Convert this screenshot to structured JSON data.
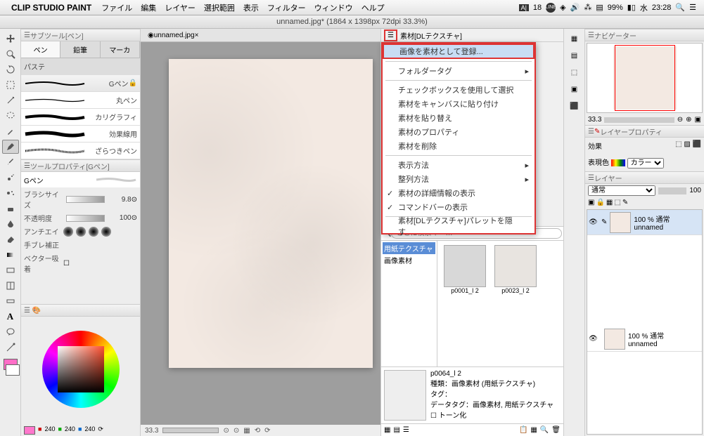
{
  "menubar": {
    "apple": "",
    "app": "CLIP STUDIO PAINT",
    "items": [
      "ファイル",
      "編集",
      "レイヤー",
      "選択範囲",
      "表示",
      "フィルター",
      "ウィンドウ",
      "ヘルプ"
    ],
    "status": {
      "adobe": "18",
      "battery": "99%",
      "day": "水",
      "time": "23:28"
    }
  },
  "titlebar": "unnamed.jpg* (1864 x 1398px 72dpi 33.3%)",
  "subtool": {
    "title": "サブツール[ペン]",
    "tabs": [
      "ペン",
      "鉛筆",
      "マーカ"
    ],
    "pastel": "パステ",
    "brushes": [
      "Gペン",
      "丸ペン",
      "カリグラフィ",
      "効果線用",
      "ざらつきペン"
    ]
  },
  "toolprop": {
    "title": "ツールプロパティ[Gペン]",
    "name": "Gペン",
    "rows": {
      "size_lbl": "ブラシサイズ",
      "size_val": "9.8",
      "opac_lbl": "不透明度",
      "opac_val": "100",
      "aa_lbl": "アンチエイ",
      "stab_lbl": "手ブレ補正",
      "vec_lbl": "ベクター吸着"
    }
  },
  "color": {
    "r": "240",
    "g": "240",
    "b": "240"
  },
  "canvas": {
    "tab": "unnamed.jpg",
    "zoom": "33.3"
  },
  "material": {
    "title": "素材[DLテクスチャ]",
    "menu": {
      "register": "画像を素材として登録...",
      "folder": "フォルダータグ",
      "chk": "チェックボックスを使用して選択",
      "paste": "素材をキャンバスに貼り付け",
      "replace": "素材を貼り替え",
      "prop": "素材のプロパティ",
      "del": "素材を削除",
      "view": "表示方法",
      "sort": "整列方法",
      "detail": "素材の詳細情報の表示",
      "cmdbar": "コマンドバーの表示",
      "hide": "素材[DLテクスチャ]パレットを隠す"
    },
    "search_ph": "ここに検索キー…",
    "tree": {
      "t1": "用紙テクスチャ",
      "t2": "画像素材"
    },
    "thumbs": [
      "p0001_l 2",
      "p0023_l 2"
    ],
    "detail": {
      "name": "p0064_l 2",
      "kind": "種類：画像素材 (用紙テクスチャ)",
      "tag": "タグ：",
      "dtag": "データタグ：画像素材, 用紙テクスチャ",
      "tone": "トーン化"
    }
  },
  "nav": {
    "title": "ナビゲーター",
    "zoom": "33.3"
  },
  "layerprop": {
    "title": "レイヤープロパティ",
    "effect": "効果",
    "expr": "表現色",
    "expr_val": "カラー"
  },
  "layers": {
    "title": "レイヤー",
    "mode": "通常",
    "opac": "100",
    "rows": [
      {
        "opac": "100 % 通常",
        "name": "unnamed"
      },
      {
        "opac": "100 % 通常",
        "name": "unnamed"
      }
    ]
  }
}
